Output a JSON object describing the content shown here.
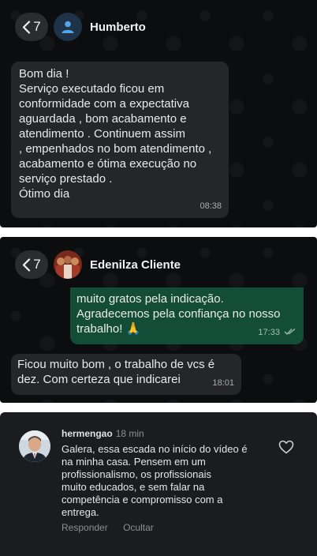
{
  "panel1": {
    "back_count": "7",
    "contact_name": "Humberto",
    "message": {
      "lines": [
        "Bom dia !",
        "Serviço executado  ficou em",
        "conformidade com a expectativa",
        "aguardada , bom acabamento e",
        "atendimento . Continuem assim",
        ", empenhados no bom atendimento ,",
        "acabamento e ótima execução no",
        "serviço prestado .",
        "Ótimo dia"
      ],
      "time": "08:38"
    }
  },
  "panel2": {
    "back_count": "7",
    "contact_name": "Edenilza Cliente",
    "outgoing": {
      "lines": [
        "muito gratos pela indicação.",
        "Agradecemos pela confiança no nosso",
        "trabalho! 🙏"
      ],
      "time": "17:33"
    },
    "incoming": {
      "lines": [
        "Ficou muito bom , o trabalho de vcs é",
        "dez. Com certeza que indicarei"
      ],
      "time": "18:01"
    }
  },
  "comment": {
    "username": "hermengao",
    "age": "18 min",
    "lines": [
      "Galera, essa escada no início do vídeo é",
      "na minha casa. Pensem em um",
      "profissionalismo,  os profissionais",
      "muito educados, e sem falar na",
      "competência e compromisso com a",
      "entrega."
    ],
    "reply_label": "Responder",
    "hide_label": "Ocultar"
  },
  "icons": {
    "back": "chevron-left-icon",
    "default_avatar": "person-icon",
    "read_receipt": "double-check-icon",
    "like": "heart-outline-icon"
  },
  "colors": {
    "chat_background": "#0b0d0e",
    "incoming_bubble": "#242628",
    "outgoing_bubble": "#144d37",
    "avatar_bg": "#1e3348",
    "avatar_icon": "#53a6e8",
    "read_ticks": "#9cb8ad"
  }
}
